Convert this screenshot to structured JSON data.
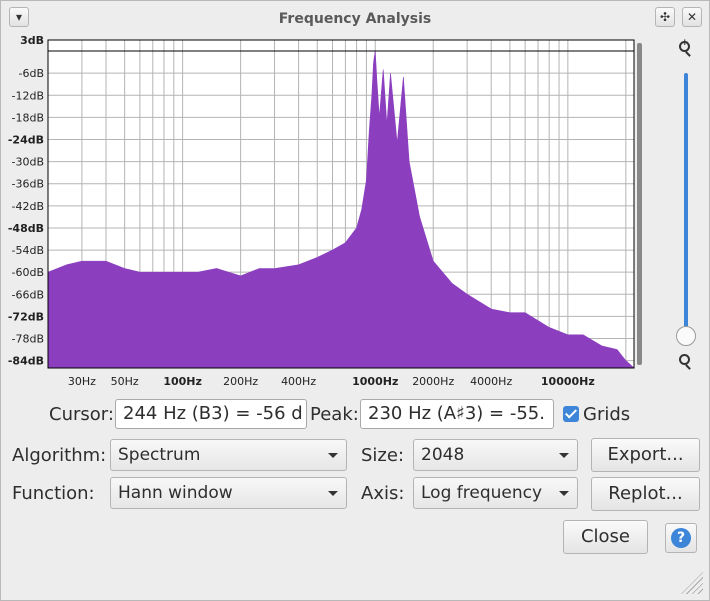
{
  "window": {
    "title": "Frequency Analysis",
    "menu_icon": "chevron-down-icon",
    "btn_max_icon": "move-icon",
    "btn_close_icon": "close-icon"
  },
  "plot": {
    "y_ticks": [
      "3dB",
      "-6dB",
      "-12dB",
      "-18dB",
      "-24dB",
      "-30dB",
      "-36dB",
      "-42dB",
      "-48dB",
      "-54dB",
      "-60dB",
      "-66dB",
      "-72dB",
      "-78dB",
      "-84dB"
    ],
    "x_ticks": [
      "30Hz",
      "50Hz",
      "100Hz",
      "200Hz",
      "400Hz",
      "1000Hz",
      "2000Hz",
      "4000Hz",
      "10000Hz"
    ],
    "fill_color": "#8b3fbf"
  },
  "chart_data": {
    "type": "area",
    "x_scale": "log",
    "xlim": [
      20,
      22050
    ],
    "ylim": [
      -86,
      3
    ],
    "x": [
      20,
      25,
      30,
      40,
      50,
      60,
      70,
      80,
      100,
      120,
      150,
      200,
      250,
      300,
      400,
      500,
      600,
      700,
      800,
      850,
      900,
      930,
      960,
      980,
      1000,
      1020,
      1050,
      1100,
      1150,
      1200,
      1300,
      1400,
      1500,
      1700,
      2000,
      2500,
      3000,
      4000,
      5000,
      6000,
      8000,
      10000,
      12000,
      15000,
      18000,
      20000,
      22050
    ],
    "y": [
      -60,
      -58,
      -57,
      -57,
      -59,
      -60,
      -60,
      -60,
      -60,
      -60,
      -59,
      -61,
      -59,
      -59,
      -58,
      -56,
      -54,
      -52,
      -48,
      -43,
      -35,
      -22,
      -12,
      -3,
      0,
      -8,
      -18,
      -5,
      -20,
      -6,
      -25,
      -7,
      -30,
      -45,
      -57,
      -63,
      -66,
      -70,
      -71,
      -71,
      -75,
      -77,
      -77,
      -80,
      -81,
      -84,
      -86
    ],
    "ylabel": "",
    "xlabel": "",
    "grid": true
  },
  "controls": {
    "cursor_label": "Cursor:",
    "cursor_value": "244 Hz (B3) = -56 d",
    "peak_label": "Peak:",
    "peak_value": "230 Hz (A♯3) = -55.",
    "grids_label": "Grids",
    "grids_checked": true,
    "algorithm_label": "Algorithm:",
    "algorithm_value": "Spectrum",
    "size_label": "Size:",
    "size_value": "2048",
    "function_label": "Function:",
    "function_value": "Hann window",
    "axis_label": "Axis:",
    "axis_value": "Log frequency",
    "export_label": "Export...",
    "replot_label": "Replot...",
    "close_label": "Close",
    "help_glyph": "?"
  }
}
